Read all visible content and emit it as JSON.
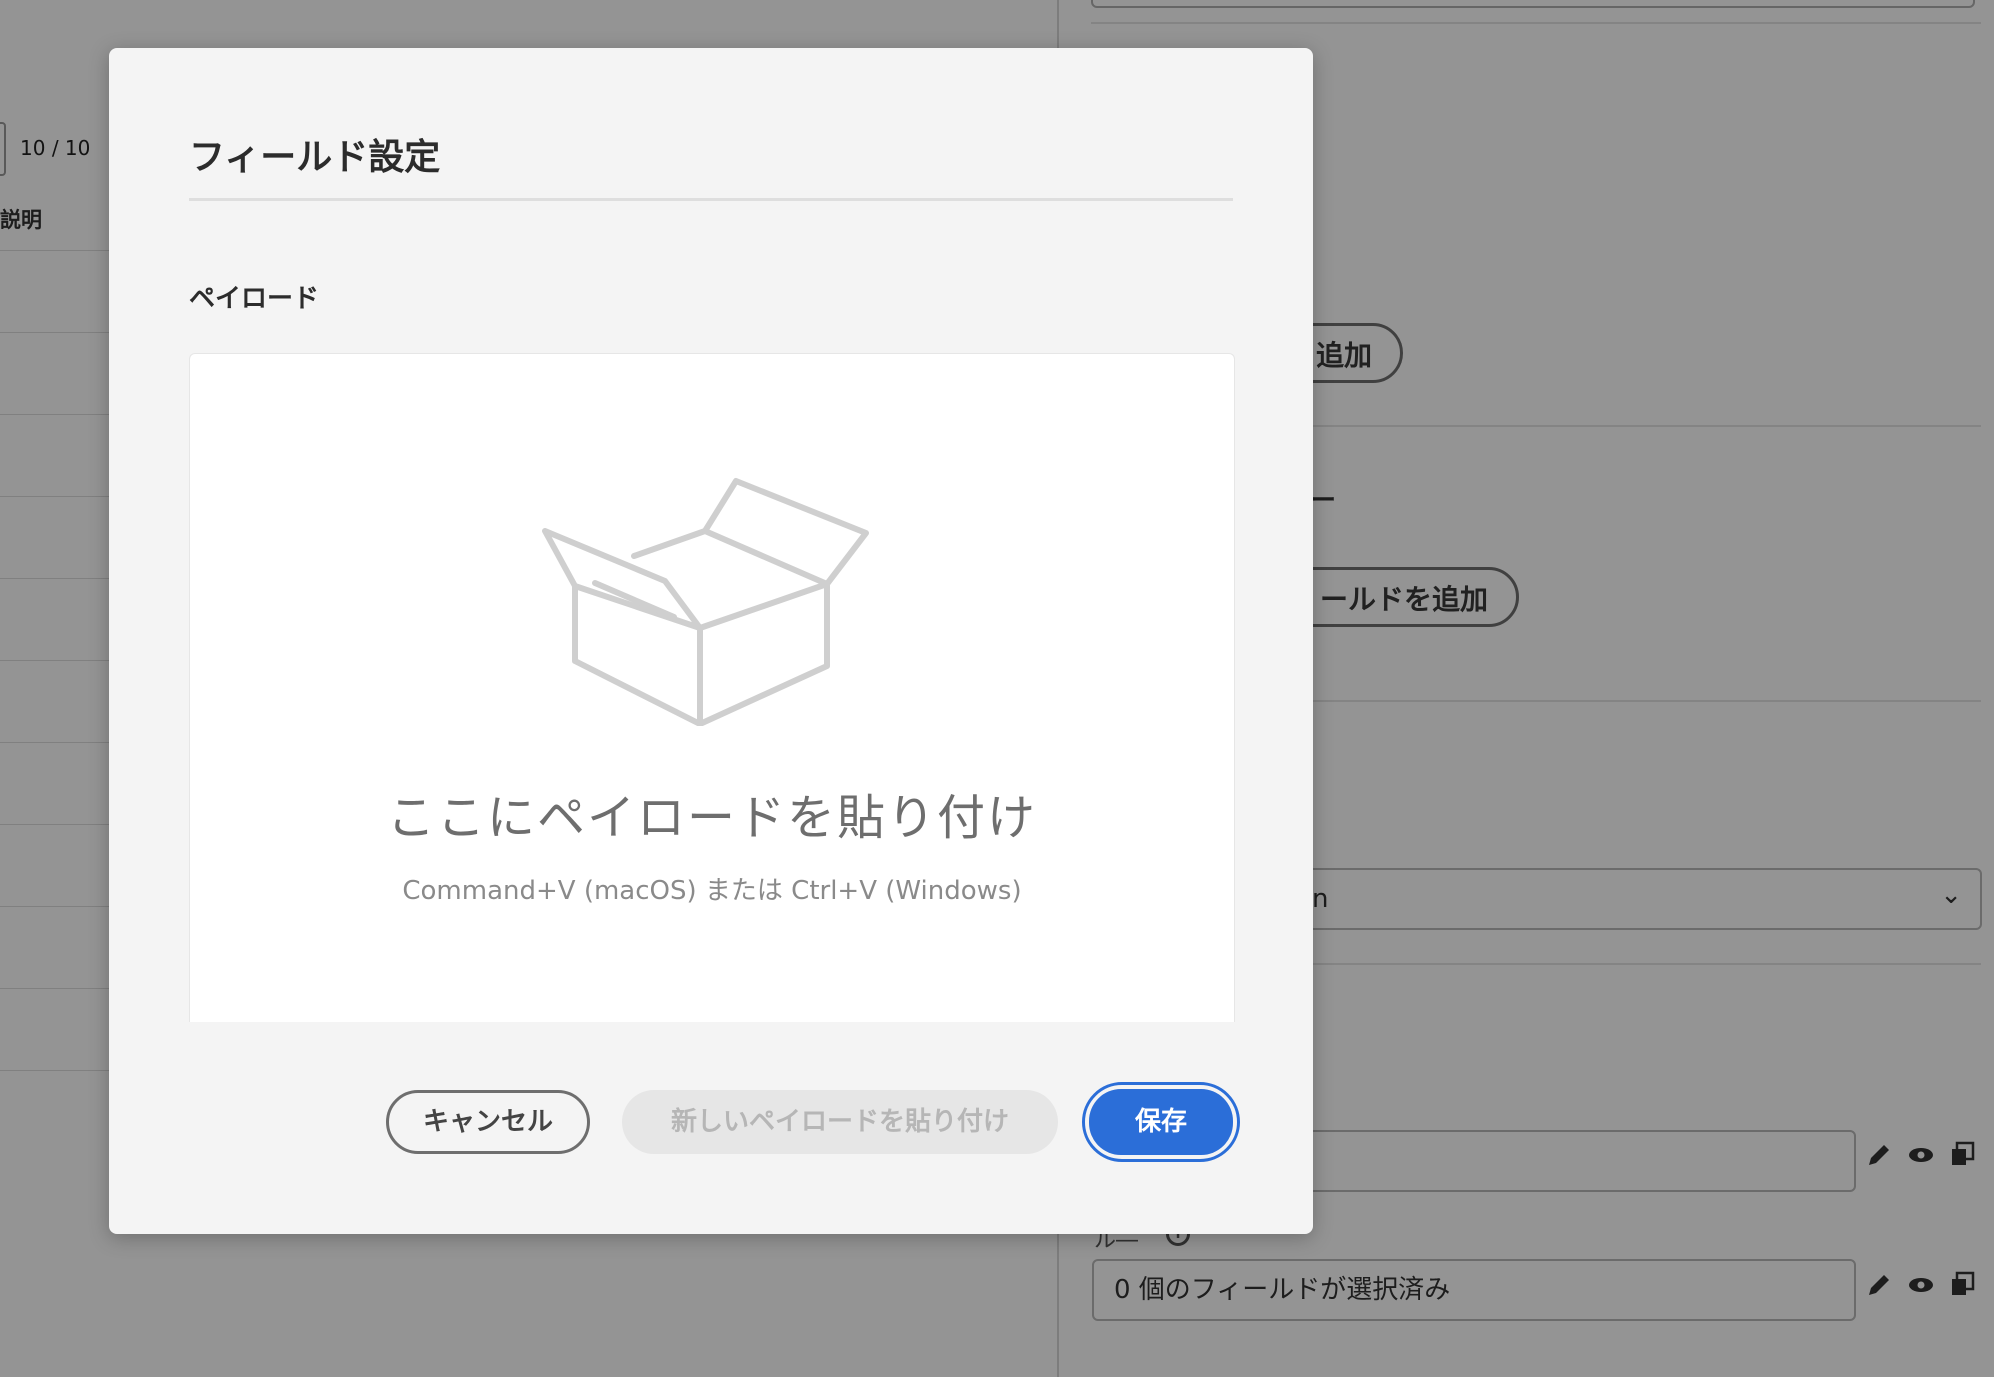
{
  "background": {
    "pagination": {
      "current": "10",
      "separator": "/",
      "total": "10"
    },
    "table": {
      "column_description": "説明"
    },
    "right_panel": {
      "add_button_1_label": "追加",
      "section_label_fragment": "ー",
      "add_field_button_label": "ールドを追加",
      "select_value_fragment": "n",
      "field_label_fragment": "",
      "selected_fields_text": "0 個のフィールドが選択済み",
      "field_row_label_fragment": "ル―"
    }
  },
  "dialog": {
    "title": "フィールド設定",
    "section_label": "ペイロード",
    "dropzone": {
      "heading": "ここにペイロードを貼り付け",
      "hint": "Command+V (macOS) または Ctrl+V (Windows)",
      "icon": "box-open-icon"
    },
    "buttons": {
      "cancel": "キャンセル",
      "paste_new": "新しいペイロードを貼り付け",
      "save": "保存"
    }
  },
  "colors": {
    "accent": "#2b6ed8",
    "overlay": "rgba(0,0,0,0.42)",
    "dialog_bg": "#f4f4f4"
  }
}
